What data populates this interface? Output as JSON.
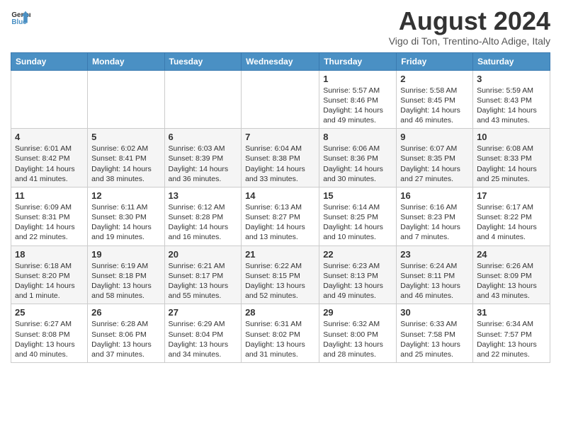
{
  "header": {
    "logo_line1": "General",
    "logo_line2": "Blue",
    "month_year": "August 2024",
    "location": "Vigo di Ton, Trentino-Alto Adige, Italy"
  },
  "days_of_week": [
    "Sunday",
    "Monday",
    "Tuesday",
    "Wednesday",
    "Thursday",
    "Friday",
    "Saturday"
  ],
  "weeks": [
    [
      {
        "day": "",
        "info": ""
      },
      {
        "day": "",
        "info": ""
      },
      {
        "day": "",
        "info": ""
      },
      {
        "day": "",
        "info": ""
      },
      {
        "day": "1",
        "info": "Sunrise: 5:57 AM\nSunset: 8:46 PM\nDaylight: 14 hours and 49 minutes."
      },
      {
        "day": "2",
        "info": "Sunrise: 5:58 AM\nSunset: 8:45 PM\nDaylight: 14 hours and 46 minutes."
      },
      {
        "day": "3",
        "info": "Sunrise: 5:59 AM\nSunset: 8:43 PM\nDaylight: 14 hours and 43 minutes."
      }
    ],
    [
      {
        "day": "4",
        "info": "Sunrise: 6:01 AM\nSunset: 8:42 PM\nDaylight: 14 hours and 41 minutes."
      },
      {
        "day": "5",
        "info": "Sunrise: 6:02 AM\nSunset: 8:41 PM\nDaylight: 14 hours and 38 minutes."
      },
      {
        "day": "6",
        "info": "Sunrise: 6:03 AM\nSunset: 8:39 PM\nDaylight: 14 hours and 36 minutes."
      },
      {
        "day": "7",
        "info": "Sunrise: 6:04 AM\nSunset: 8:38 PM\nDaylight: 14 hours and 33 minutes."
      },
      {
        "day": "8",
        "info": "Sunrise: 6:06 AM\nSunset: 8:36 PM\nDaylight: 14 hours and 30 minutes."
      },
      {
        "day": "9",
        "info": "Sunrise: 6:07 AM\nSunset: 8:35 PM\nDaylight: 14 hours and 27 minutes."
      },
      {
        "day": "10",
        "info": "Sunrise: 6:08 AM\nSunset: 8:33 PM\nDaylight: 14 hours and 25 minutes."
      }
    ],
    [
      {
        "day": "11",
        "info": "Sunrise: 6:09 AM\nSunset: 8:31 PM\nDaylight: 14 hours and 22 minutes."
      },
      {
        "day": "12",
        "info": "Sunrise: 6:11 AM\nSunset: 8:30 PM\nDaylight: 14 hours and 19 minutes."
      },
      {
        "day": "13",
        "info": "Sunrise: 6:12 AM\nSunset: 8:28 PM\nDaylight: 14 hours and 16 minutes."
      },
      {
        "day": "14",
        "info": "Sunrise: 6:13 AM\nSunset: 8:27 PM\nDaylight: 14 hours and 13 minutes."
      },
      {
        "day": "15",
        "info": "Sunrise: 6:14 AM\nSunset: 8:25 PM\nDaylight: 14 hours and 10 minutes."
      },
      {
        "day": "16",
        "info": "Sunrise: 6:16 AM\nSunset: 8:23 PM\nDaylight: 14 hours and 7 minutes."
      },
      {
        "day": "17",
        "info": "Sunrise: 6:17 AM\nSunset: 8:22 PM\nDaylight: 14 hours and 4 minutes."
      }
    ],
    [
      {
        "day": "18",
        "info": "Sunrise: 6:18 AM\nSunset: 8:20 PM\nDaylight: 14 hours and 1 minute."
      },
      {
        "day": "19",
        "info": "Sunrise: 6:19 AM\nSunset: 8:18 PM\nDaylight: 13 hours and 58 minutes."
      },
      {
        "day": "20",
        "info": "Sunrise: 6:21 AM\nSunset: 8:17 PM\nDaylight: 13 hours and 55 minutes."
      },
      {
        "day": "21",
        "info": "Sunrise: 6:22 AM\nSunset: 8:15 PM\nDaylight: 13 hours and 52 minutes."
      },
      {
        "day": "22",
        "info": "Sunrise: 6:23 AM\nSunset: 8:13 PM\nDaylight: 13 hours and 49 minutes."
      },
      {
        "day": "23",
        "info": "Sunrise: 6:24 AM\nSunset: 8:11 PM\nDaylight: 13 hours and 46 minutes."
      },
      {
        "day": "24",
        "info": "Sunrise: 6:26 AM\nSunset: 8:09 PM\nDaylight: 13 hours and 43 minutes."
      }
    ],
    [
      {
        "day": "25",
        "info": "Sunrise: 6:27 AM\nSunset: 8:08 PM\nDaylight: 13 hours and 40 minutes."
      },
      {
        "day": "26",
        "info": "Sunrise: 6:28 AM\nSunset: 8:06 PM\nDaylight: 13 hours and 37 minutes."
      },
      {
        "day": "27",
        "info": "Sunrise: 6:29 AM\nSunset: 8:04 PM\nDaylight: 13 hours and 34 minutes."
      },
      {
        "day": "28",
        "info": "Sunrise: 6:31 AM\nSunset: 8:02 PM\nDaylight: 13 hours and 31 minutes."
      },
      {
        "day": "29",
        "info": "Sunrise: 6:32 AM\nSunset: 8:00 PM\nDaylight: 13 hours and 28 minutes."
      },
      {
        "day": "30",
        "info": "Sunrise: 6:33 AM\nSunset: 7:58 PM\nDaylight: 13 hours and 25 minutes."
      },
      {
        "day": "31",
        "info": "Sunrise: 6:34 AM\nSunset: 7:57 PM\nDaylight: 13 hours and 22 minutes."
      }
    ]
  ]
}
